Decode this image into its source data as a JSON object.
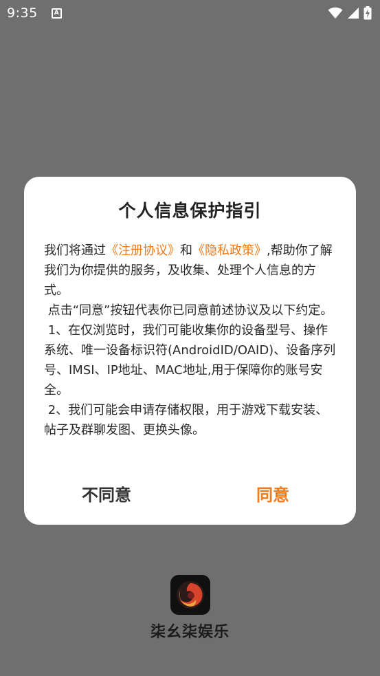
{
  "status_bar": {
    "time": "9:35",
    "notification_glyph": "A",
    "icons": [
      "notification-icon",
      "wifi-icon",
      "cellular-signal-icon",
      "battery-charging-icon"
    ]
  },
  "background_app": {
    "app_name": "柒幺柒娱乐",
    "logo_icon": "app-logo-icon"
  },
  "dialog": {
    "title": "个人信息保护指引",
    "paragraphs": {
      "p1_pre": "我们将通过",
      "p1_link1": "《注册协议》",
      "p1_mid": "和",
      "p1_link2": "《隐私政策》",
      "p1_post": ",帮助你了解我们为你提供的服务，及收集、处理个人信息的方式。",
      "p2": " 点击“同意”按钮代表你已同意前述协议及以下约定。",
      "p3": " 1、在仅浏览时，我们可能收集你的设备型号、操作系统、唯一设备标识符(AndroidID/OAID)、设备序列号、IMSI、IP地址、MAC地址,用于保障你的账号安全。",
      "p4": " 2、我们可能会申请存储权限，用于游戏下载安装、帖子及群聊发图、更换头像。"
    },
    "buttons": {
      "disagree": "不同意",
      "agree": "同意"
    }
  },
  "colors": {
    "accent": "#ef7a1a",
    "scrim": "#6f6f6f",
    "dialog_bg": "#ffffff"
  }
}
